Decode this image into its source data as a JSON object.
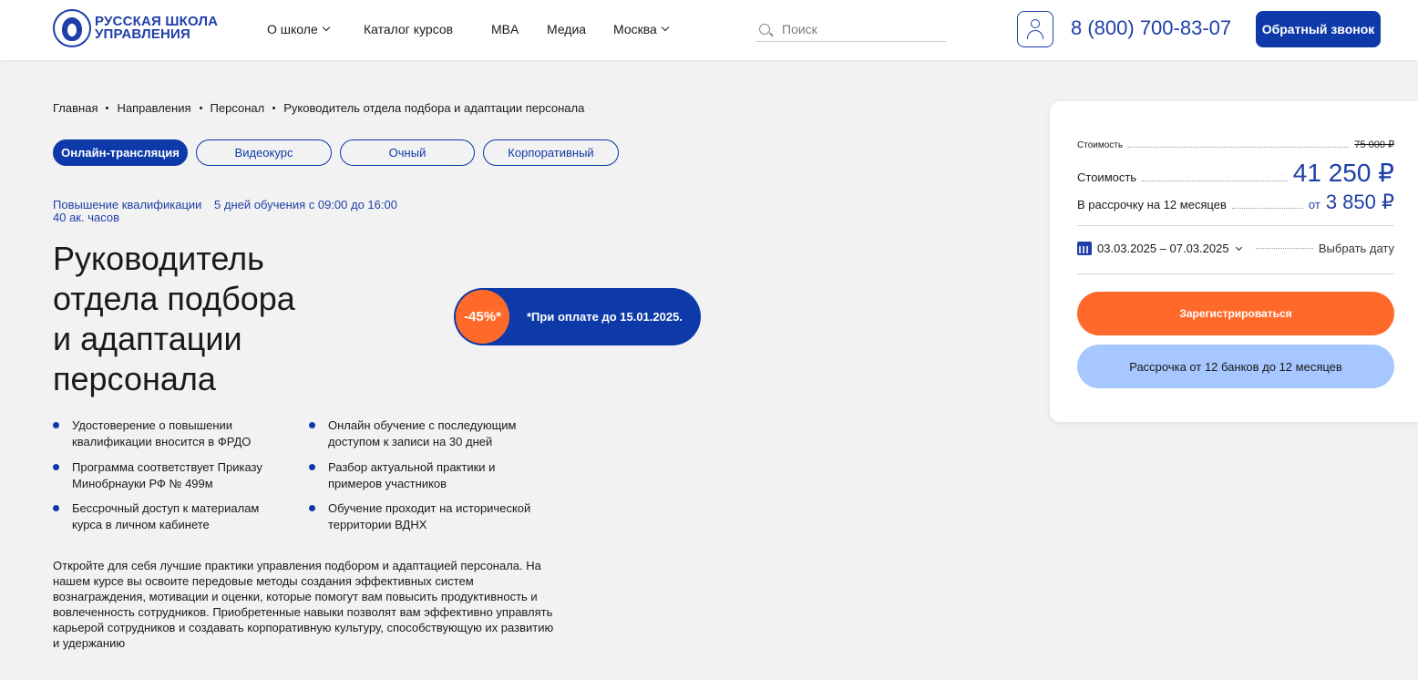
{
  "header": {
    "logo_line1": "РУССКАЯ ШКОЛА",
    "logo_line2": "УПРАВЛЕНИЯ",
    "nav": [
      {
        "label": "О школе",
        "has_dropdown": true
      },
      {
        "label": "Каталог курсов",
        "has_dropdown": false
      },
      {
        "label": "MBA",
        "has_dropdown": false
      },
      {
        "label": "Медиа",
        "has_dropdown": false
      },
      {
        "label": "Москва",
        "has_dropdown": true
      }
    ],
    "search_placeholder": "Поиск",
    "phone": "8 (800) 700-83-07",
    "callback_label": "Обратный звонок"
  },
  "breadcrumb": [
    "Главная",
    "Направления",
    "Персонал",
    "Руководитель отдела подбора и адаптации персонала"
  ],
  "format_tabs": [
    {
      "label": "Онлайн-трансляция",
      "active": true
    },
    {
      "label": "Видеокурс",
      "active": false
    },
    {
      "label": "Очный",
      "active": false
    },
    {
      "label": "Корпоративный",
      "active": false
    }
  ],
  "course": {
    "type": "Повышение квалификации",
    "schedule": "5 дней обучения с 09:00 до 16:00",
    "hours": "40 ак. часов",
    "title_lines": [
      "Руководитель",
      "отдела подбора",
      "и адаптации",
      "персонала"
    ],
    "features": [
      "Удостоверение о повышении квалификации вносится в ФРДО",
      "Онлайн обучение с последующим доступом к записи на 30 дней",
      "Программа соответствует Приказу Минобрнауки РФ № 499м",
      "Разбор актуальной практики и примеров участников",
      "Бессрочный доступ к материалам курса в личном кабинете",
      "Обучение проходит на исторической территории ВДНХ"
    ],
    "description": "Откройте для себя лучшие практики управления подбором и адаптацией персонала. На нашем курсе вы освоите передовые методы создания эффективных систем вознаграждения, мотивации и оценки, которые помогут вам повысить продуктивность и вовлеченность сотрудников. Приобретенные навыки позволят вам эффективно управлять карьерой сотрудников и создавать корпоративную культуру, способствующую их развитию и удержанию"
  },
  "promo": {
    "discount": "-45%*",
    "note": "*При оплате до 15.01.2025."
  },
  "price_card": {
    "old_price_label": "Стоимость",
    "old_price": "75 000 ₽",
    "price_label": "Стоимость",
    "price": "41 250 ₽",
    "installment_label": "В рассрочку на 12 месяцев",
    "installment_prefix": "от",
    "installment_price": "3 850 ₽",
    "date_range": "03.03.2025 – 07.03.2025",
    "choose_date": "Выбрать дату",
    "register_label": "Зарегистрироваться",
    "loan_label": "Рассрочка от 12 банков до 12 месяцев"
  },
  "colors": {
    "brand_blue": "#0d3aa8",
    "accent_orange": "#ff6a2a",
    "light_blue": "#a6c7ff",
    "background": "#f2f2f2"
  }
}
